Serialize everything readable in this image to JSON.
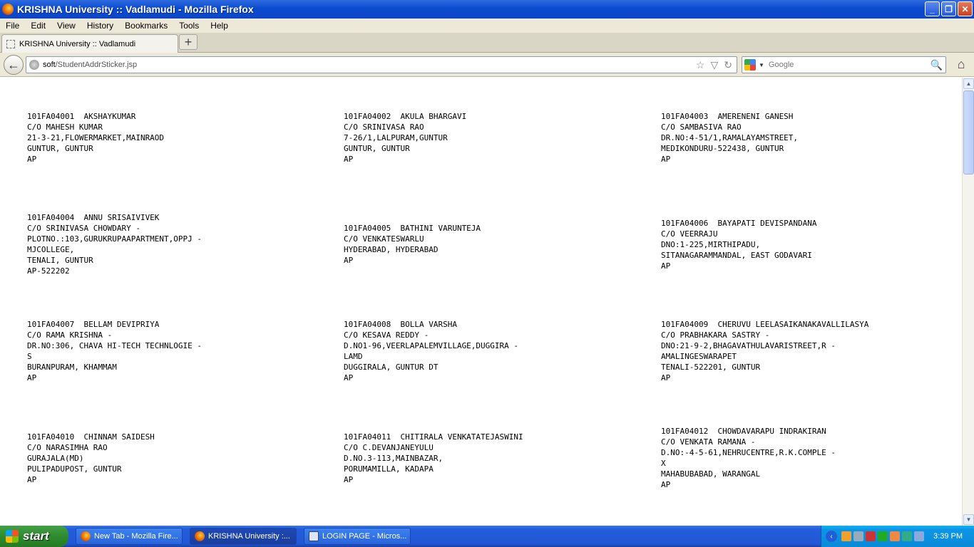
{
  "window": {
    "title": "KRISHNA University :: Vadlamudi - Mozilla Firefox"
  },
  "menu": [
    "File",
    "Edit",
    "View",
    "History",
    "Bookmarks",
    "Tools",
    "Help"
  ],
  "tab": {
    "title": "KRISHNA University :: Vadlamudi"
  },
  "address": {
    "host": "soft",
    "path": "/StudentAddrSticker.jsp"
  },
  "search": {
    "placeholder": "Google"
  },
  "cards": [
    [
      "101FA04001  AKSHAYKUMAR",
      "C/O MAHESH KUMAR",
      "21-3-21,FLOWERMARKET,MAINRAOD",
      "GUNTUR, GUNTUR",
      "AP"
    ],
    [
      "101FA04002  AKULA BHARGAVI",
      "C/O SRINIVASA RAO",
      "7-26/1,LALPURAM,GUNTUR",
      "GUNTUR, GUNTUR",
      "AP"
    ],
    [
      "101FA04003  AMERENENI GANESH",
      "C/O SAMBASIVA RAO",
      "DR.NO:4-51/1,RAMALAYAMSTREET,",
      "MEDIKONDURU-522438, GUNTUR",
      "AP"
    ],
    [
      "101FA04004  ANNU SRISAIVIVEK",
      "C/O SRINIVASA CHOWDARY -",
      "PLOTNO.:103,GURUKRUPAAPARTMENT,OPPJ -",
      "MJCOLLEGE,",
      "TENALI, GUNTUR",
      "AP-522202"
    ],
    [
      "101FA04005  BATHINI VARUNTEJA",
      "C/O VENKATESWARLU",
      "HYDERABAD, HYDERABAD",
      "AP"
    ],
    [
      "101FA04006  BAYAPATI DEVISPANDANA",
      "C/O VEERRAJU",
      "DNO:1-225,MIRTHIPADU,",
      "SITANAGARAMMANDAL, EAST GODAVARI",
      "AP"
    ],
    [
      "101FA04007  BELLAM DEVIPRIYA",
      "C/O RAMA KRISHNA -",
      "DR.NO:306, CHAVA HI-TECH TECHNLOGIE -",
      "S",
      "BURANPURAM, KHAMMAM",
      "AP"
    ],
    [
      "101FA04008  BOLLA VARSHA",
      "C/O KESAVA REDDY -",
      "D.NO1-96,VEERLAPALEMVILLAGE,DUGGIRA -",
      "LAMD",
      "DUGGIRALA, GUNTUR DT",
      "AP"
    ],
    [
      "101FA04009  CHERUVU LEELASAIKANAKAVALLILASYA",
      "C/O PRABHAKARA SASTRY -",
      "DNO:21-9-2,BHAGAVATHULAVARISTREET,R -",
      "AMALINGESWARAPET",
      "TENALI-522201, GUNTUR",
      "AP"
    ],
    [
      "101FA04010  CHINNAM SAIDESH",
      "C/O NARASIMHA RAO",
      "GURAJALA(MD)",
      "PULIPADUPOST, GUNTUR",
      "AP"
    ],
    [
      "101FA04011  CHITIRALA VENKATATEJASWINI",
      "C/O C.DEVANJANEYULU",
      "D.NO.3-113,MAINBAZAR,",
      "PORUMAMILLA, KADAPA",
      "AP"
    ],
    [
      "101FA04012  CHOWDAVARAPU INDRAKIRAN",
      "C/O VENKATA RAMANA -",
      "D.NO:-4-5-61,NEHRUCENTRE,R.K.COMPLE -",
      "X",
      "MAHABUBABAD, WARANGAL",
      "AP"
    ]
  ],
  "taskbar": {
    "start": "start",
    "tasks": [
      "New Tab - Mozilla Fire...",
      "KRISHNA University :...",
      "LOGIN PAGE - Micros..."
    ],
    "clock": "3:39 PM"
  }
}
